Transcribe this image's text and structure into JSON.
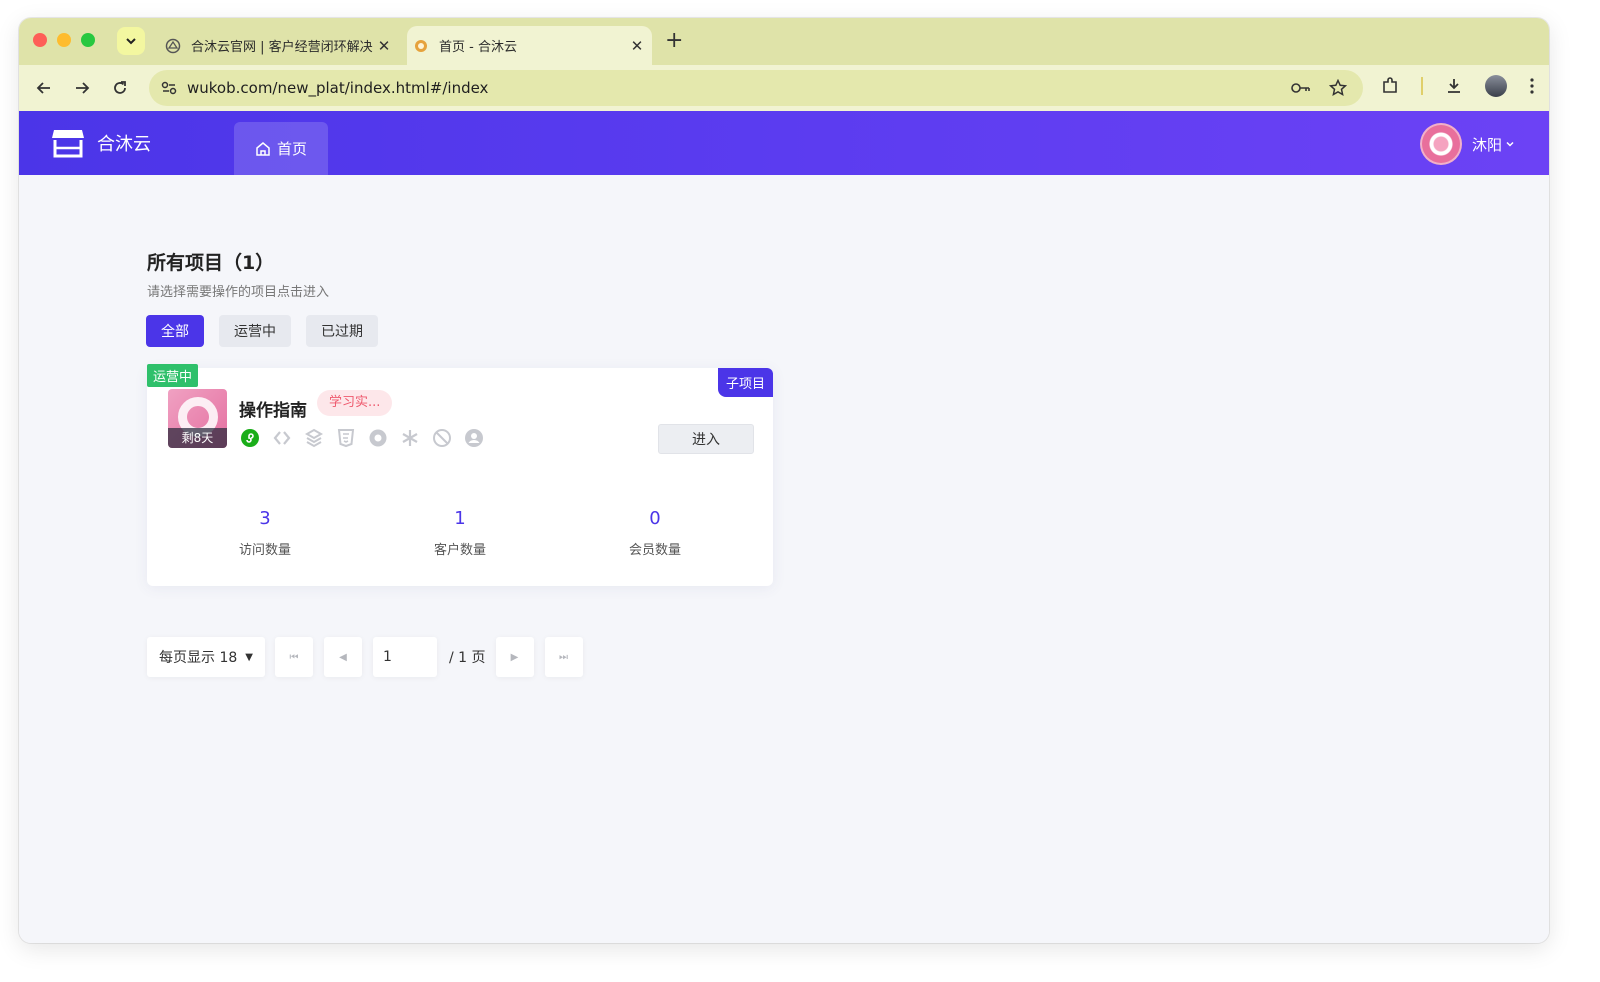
{
  "browser": {
    "tabs": [
      {
        "title": "合沐云官网 | 客户经营闭环解决"
      },
      {
        "title": "首页 - 合沐云"
      }
    ],
    "url": "wukob.com/new_plat/index.html#/index"
  },
  "header": {
    "brand": "合沐云",
    "nav_home": "首页",
    "user_name": "沐阳"
  },
  "main": {
    "title": "所有项目（1）",
    "subtitle": "请选择需要操作的项目点击进入",
    "filters": [
      "全部",
      "运营中",
      "已过期"
    ],
    "active_filter": "全部"
  },
  "project": {
    "status": "运营中",
    "type": "子项目",
    "name": "操作指南",
    "tag": "学习实...",
    "remaining": "剩8天",
    "enter_label": "进入",
    "stats": [
      {
        "value": "3",
        "label": "访问数量"
      },
      {
        "value": "1",
        "label": "客户数量"
      },
      {
        "value": "0",
        "label": "会员数量"
      }
    ],
    "channel_icons": [
      "miniprogram-icon",
      "code-icon",
      "layers-icon",
      "html5-icon",
      "chrome-icon",
      "asterisk-icon",
      "blocked-icon",
      "user-circle-icon"
    ]
  },
  "pagination": {
    "per_page": "每页显示 18",
    "current": "1",
    "total": "/ 1 页"
  },
  "colors": {
    "primary": "#4b35e8",
    "running": "#2fc06b",
    "tag_text": "#ee5a6e"
  }
}
